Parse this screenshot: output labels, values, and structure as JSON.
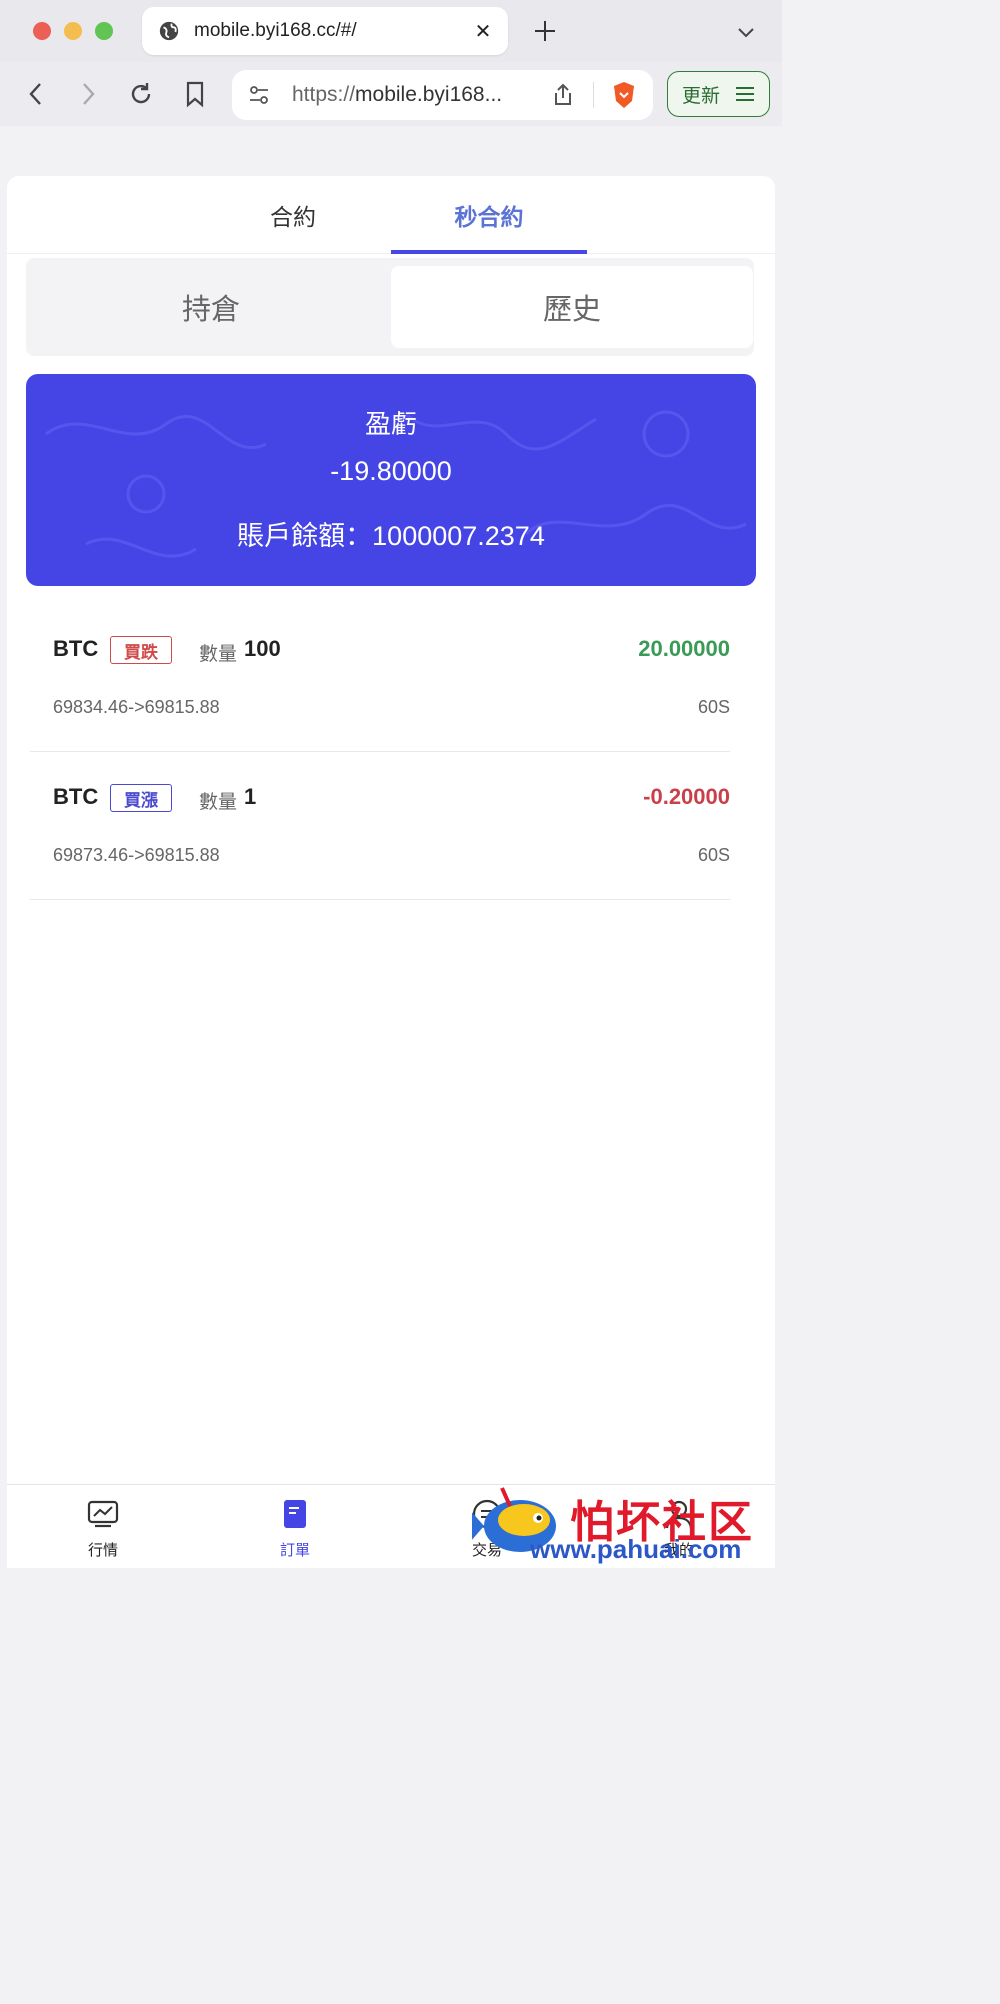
{
  "browser": {
    "tab_title": "mobile.byi168.cc/#/",
    "url_scheme": "https://",
    "url_host": "mobile.byi168...",
    "update_label": "更新"
  },
  "page": {
    "top_tabs": [
      {
        "label": "合約",
        "active": false
      },
      {
        "label": "秒合約",
        "active": true
      }
    ],
    "sub_tabs": [
      {
        "label": "持倉",
        "active": false
      },
      {
        "label": "歷史",
        "active": true
      }
    ],
    "summary": {
      "title": "盈虧",
      "pnl": "-19.80000",
      "balance": "賬戶餘額：1000007.2374"
    },
    "orders": [
      {
        "symbol": "BTC",
        "direction": "買跌",
        "qty_label": "數量",
        "qty": "100",
        "pnl": "20.00000",
        "price_change": "69834.46->69815.88",
        "duration": "60S"
      },
      {
        "symbol": "BTC",
        "direction": "買漲",
        "qty_label": "數量",
        "qty": "1",
        "pnl": "-0.20000",
        "price_change": "69873.46->69815.88",
        "duration": "60S"
      }
    ],
    "bottom_nav": [
      {
        "label": "行情",
        "icon": "chart-icon"
      },
      {
        "label": "訂單",
        "icon": "order-icon"
      },
      {
        "label": "交易",
        "icon": "trade-icon"
      },
      {
        "label": "我的",
        "icon": "profile-icon"
      }
    ]
  },
  "watermark": {
    "text": "怕坏社区",
    "url": "www.pahuai.com"
  },
  "colors": {
    "accent": "#4545e6",
    "positive": "#3a9a56",
    "negative": "#c9404a"
  }
}
